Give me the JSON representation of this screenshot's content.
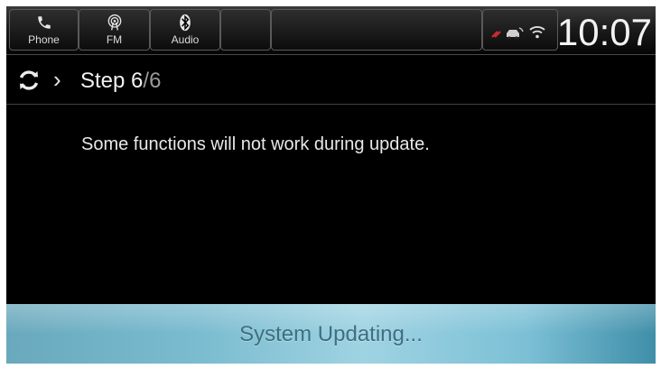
{
  "header": {
    "tabs": [
      {
        "label": "Phone",
        "icon": "phone-icon"
      },
      {
        "label": "FM",
        "icon": "radio-icon"
      },
      {
        "label": "Audio",
        "icon": "bluetooth-icon"
      }
    ],
    "status_icons": [
      "signal-icon",
      "car-connection-icon",
      "wifi-icon"
    ],
    "clock": "10:07"
  },
  "step": {
    "icon": "refresh-icon",
    "prefix": "Step ",
    "current": "6",
    "total": "/6"
  },
  "message": "Some functions will not work during update.",
  "footer": {
    "status": "System Updating..."
  },
  "colors": {
    "background": "#000000",
    "update_bar": "#7bbcd0",
    "update_text": "#3d6f80"
  }
}
